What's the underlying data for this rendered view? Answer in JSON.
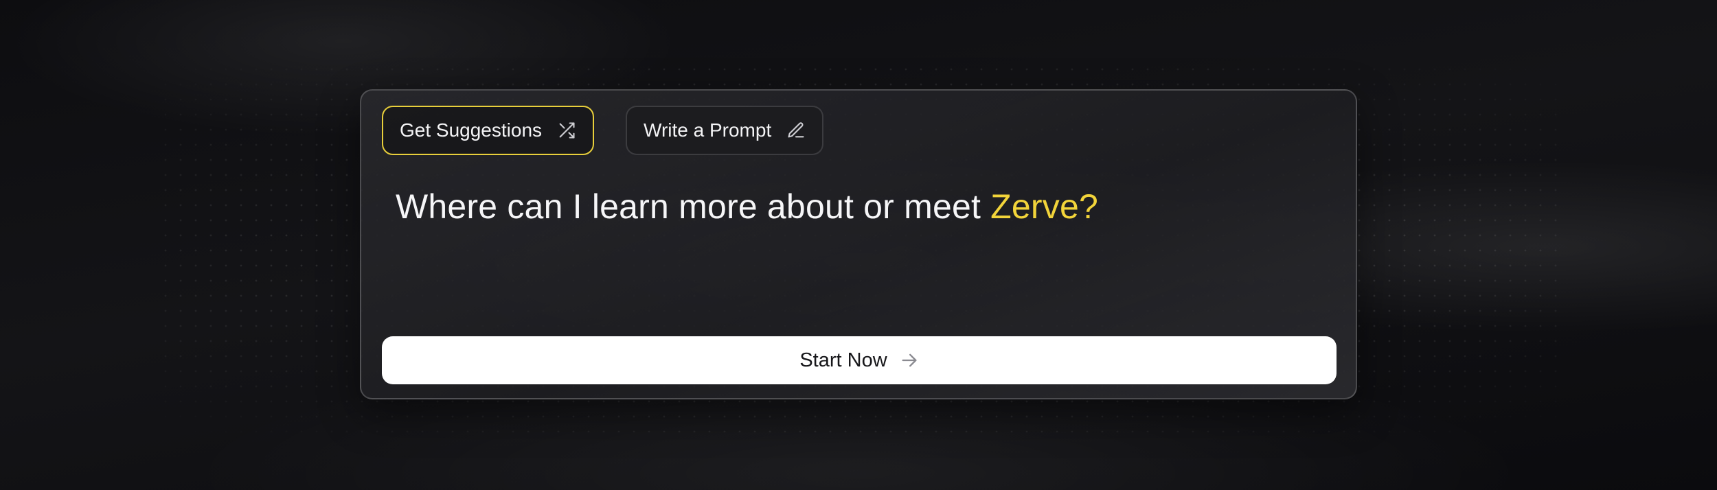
{
  "tabs": [
    {
      "label": "Get Suggestions",
      "icon": "shuffle-icon",
      "active": true
    },
    {
      "label": "Write a Prompt",
      "icon": "pencil-icon",
      "active": false
    }
  ],
  "prompt": {
    "text": "Where can I learn more about or meet",
    "highlight": "Zerve?"
  },
  "start_button": {
    "label": "Start Now",
    "icon": "arrow-right-icon"
  },
  "colors": {
    "accent": "#f2d43a",
    "active_border": "#e8cf3b",
    "background": "#0b0b0e",
    "button_bg": "#ffffff"
  }
}
